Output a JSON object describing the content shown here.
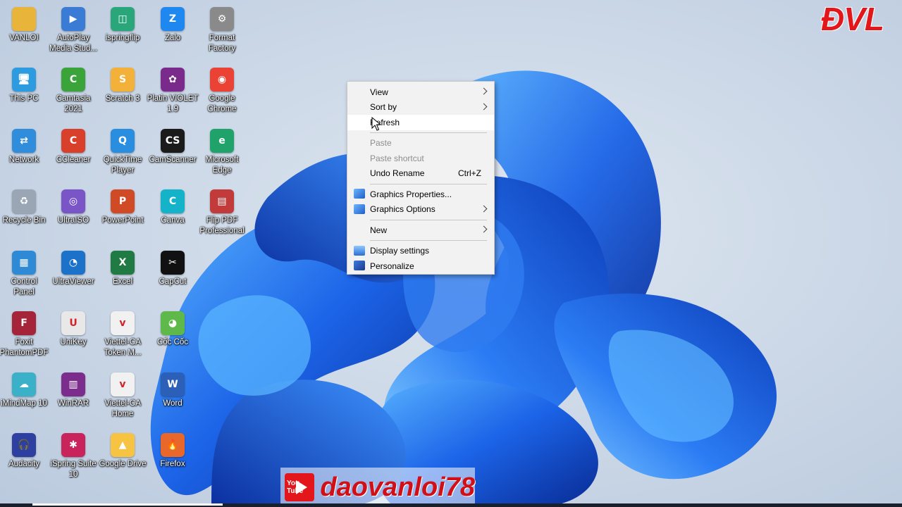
{
  "brand": {
    "logo_text": "ĐVL"
  },
  "channel": {
    "yt_badge": "You Tube",
    "name": "daovanloi78"
  },
  "desktop_icons": [
    {
      "label": "VANLOI",
      "icon": "folder-user-icon",
      "color": "#e8b53a",
      "glyph": ""
    },
    {
      "label": "AutoPlay\nMedia Stud...",
      "icon": "autoplay-icon",
      "color": "#3a7bd5",
      "glyph": "▶"
    },
    {
      "label": "ispringflip",
      "icon": "ispring-flip-icon",
      "color": "#2aa77a",
      "glyph": "◫"
    },
    {
      "label": "Zalo",
      "icon": "zalo-icon",
      "color": "#1e88f0",
      "glyph": "Z"
    },
    {
      "label": "Format\nFactory",
      "icon": "format-factory-icon",
      "color": "#8a8a8a",
      "glyph": "⚙"
    },
    {
      "label": "This PC",
      "icon": "computer-icon",
      "color": "#2d9be0",
      "glyph": "🖥"
    },
    {
      "label": "Camtasia\n2021",
      "icon": "camtasia-icon",
      "color": "#3aa33a",
      "glyph": "C"
    },
    {
      "label": "Scratch 3",
      "icon": "scratch-icon",
      "color": "#f4b13a",
      "glyph": "S"
    },
    {
      "label": "Platin VIOLET\n1.9",
      "icon": "violet-flower-icon",
      "color": "#7a2a8a",
      "glyph": "✿"
    },
    {
      "label": "Google\nChrome",
      "icon": "chrome-icon",
      "color": "#ea4335",
      "glyph": "◉"
    },
    {
      "label": "Network",
      "icon": "network-icon",
      "color": "#2f8ddb",
      "glyph": "⇄"
    },
    {
      "label": "CCleaner",
      "icon": "ccleaner-icon",
      "color": "#d9402b",
      "glyph": "C"
    },
    {
      "label": "QuickTime\nPlayer",
      "icon": "quicktime-icon",
      "color": "#2a8ee0",
      "glyph": "Q"
    },
    {
      "label": "CamScanner",
      "icon": "camscanner-icon",
      "color": "#1b1b1b",
      "glyph": "CS"
    },
    {
      "label": "Microsoft\nEdge",
      "icon": "edge-icon",
      "color": "#1fa36b",
      "glyph": "e"
    },
    {
      "label": "Recycle Bin",
      "icon": "recycle-bin-icon",
      "color": "#9aa6b3",
      "glyph": "♻"
    },
    {
      "label": "UltraISO",
      "icon": "ultraiso-icon",
      "color": "#7a55c8",
      "glyph": "◎"
    },
    {
      "label": "PowerPoint",
      "icon": "powerpoint-icon",
      "color": "#d04b25",
      "glyph": "P"
    },
    {
      "label": "Canva",
      "icon": "canva-icon",
      "color": "#15b3c9",
      "glyph": "C"
    },
    {
      "label": "Flip PDF\nProfessional",
      "icon": "flip-pdf-icon",
      "color": "#c23a3a",
      "glyph": "▤"
    },
    {
      "label": "Control\nPanel",
      "icon": "control-panel-icon",
      "color": "#2f8ad6",
      "glyph": "▦"
    },
    {
      "label": "UltraViewer",
      "icon": "ultraviewer-icon",
      "color": "#1c72c9",
      "glyph": "◔"
    },
    {
      "label": "Excel",
      "icon": "excel-icon",
      "color": "#1f7a43",
      "glyph": "X"
    },
    {
      "label": "CapCut",
      "icon": "capcut-icon",
      "color": "#111111",
      "glyph": "✂"
    },
    {
      "label": "",
      "icon": "",
      "color": "",
      "glyph": ""
    },
    {
      "label": "Foxit\nPhantomPDF",
      "icon": "foxit-icon",
      "color": "#a6243a",
      "glyph": "F"
    },
    {
      "label": "UniKey",
      "icon": "unikey-icon",
      "color": "#e8e8e8",
      "glyph": "U"
    },
    {
      "label": "Viettel-CA\nToken M...",
      "icon": "viettel-token-icon",
      "color": "#f1f1f1",
      "glyph": "v"
    },
    {
      "label": "Cốc Cốc",
      "icon": "coccoc-icon",
      "color": "#5fb84a",
      "glyph": "◕"
    },
    {
      "label": "",
      "icon": "",
      "color": "",
      "glyph": ""
    },
    {
      "label": "iMindMap 10",
      "icon": "imindmap-icon",
      "color": "#3ab0c9",
      "glyph": "☁"
    },
    {
      "label": "WinRAR",
      "icon": "winrar-icon",
      "color": "#7b2c8c",
      "glyph": "▥"
    },
    {
      "label": "Viettel-CA\nHome",
      "icon": "viettel-home-icon",
      "color": "#f1f1f1",
      "glyph": "v"
    },
    {
      "label": "Word",
      "icon": "word-icon",
      "color": "#2b5fb8",
      "glyph": "W"
    },
    {
      "label": "",
      "icon": "",
      "color": "",
      "glyph": ""
    },
    {
      "label": "Audacity",
      "icon": "audacity-icon",
      "color": "#2d3fa0",
      "glyph": "🎧"
    },
    {
      "label": "iSpring Suite\n10",
      "icon": "ispring-suite-icon",
      "color": "#c8235a",
      "glyph": "✱"
    },
    {
      "label": "Google Drive",
      "icon": "google-drive-icon",
      "color": "#f6c343",
      "glyph": "▲"
    },
    {
      "label": "Firefox",
      "icon": "firefox-icon",
      "color": "#e8682b",
      "glyph": "🔥"
    },
    {
      "label": "",
      "icon": "",
      "color": "",
      "glyph": ""
    }
  ],
  "context_menu": {
    "items": [
      {
        "label": "View",
        "submenu": true,
        "disabled": false,
        "hover": false
      },
      {
        "label": "Sort by",
        "submenu": true,
        "disabled": false,
        "hover": false
      },
      {
        "label": "Refresh",
        "submenu": false,
        "disabled": false,
        "hover": true
      },
      {
        "separator": true
      },
      {
        "label": "Paste",
        "submenu": false,
        "disabled": true,
        "hover": false
      },
      {
        "label": "Paste shortcut",
        "submenu": false,
        "disabled": true,
        "hover": false
      },
      {
        "label": "Undo Rename",
        "shortcut": "Ctrl+Z",
        "submenu": false,
        "disabled": false,
        "hover": false
      },
      {
        "separator": true
      },
      {
        "label": "Graphics Properties...",
        "icon": "intel-graphics-icon",
        "submenu": false,
        "disabled": false,
        "hover": false
      },
      {
        "label": "Graphics Options",
        "icon": "intel-graphics-icon",
        "submenu": true,
        "disabled": false,
        "hover": false
      },
      {
        "separator": true
      },
      {
        "label": "New",
        "submenu": true,
        "disabled": false,
        "hover": false
      },
      {
        "separator": true
      },
      {
        "label": "Display settings",
        "icon": "display-icon",
        "submenu": false,
        "disabled": false,
        "hover": false
      },
      {
        "label": "Personalize",
        "icon": "personalize-icon",
        "submenu": false,
        "disabled": false,
        "hover": false
      }
    ]
  },
  "colors": {
    "wallpaper_bg": "#c9d6e6",
    "bloom_dark": "#0a2f9e",
    "bloom_mid": "#1f5fe0",
    "bloom_light": "#4aa3ff",
    "menu_bg": "#f2f2f2",
    "brand_red": "#e3161c"
  }
}
